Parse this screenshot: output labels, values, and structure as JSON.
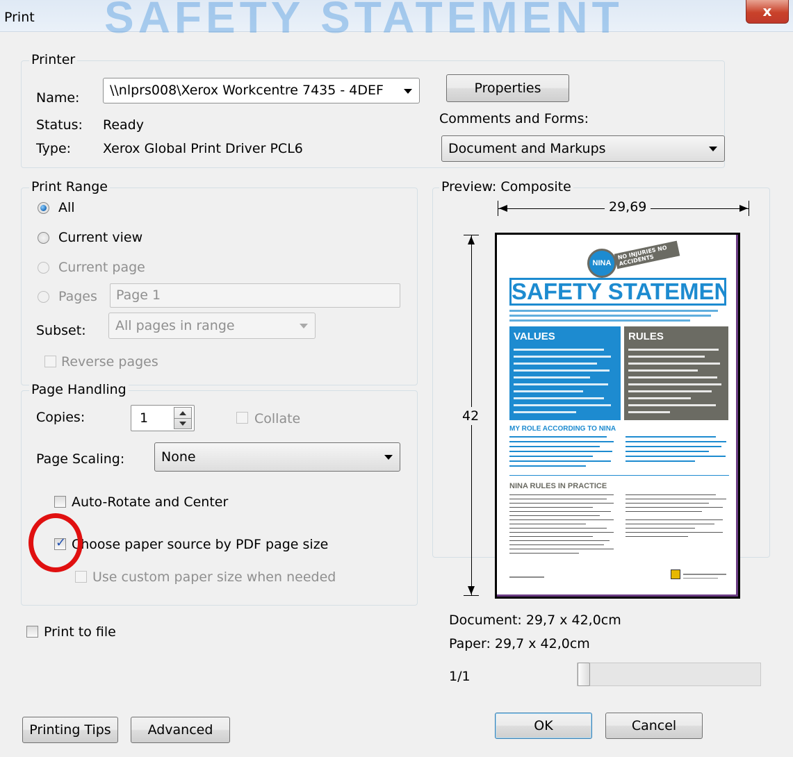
{
  "window": {
    "title": "Print",
    "background_watermark": "SAFETY STATEMENT",
    "close_glyph": "x"
  },
  "printer": {
    "legend": "Printer",
    "name_label": "Name:",
    "name_value": "\\\\nlprs008\\Xerox Workcentre 7435 - 4DEF",
    "status_label": "Status:",
    "status_value": "Ready",
    "type_label": "Type:",
    "type_value": "Xerox Global Print Driver PCL6",
    "properties_button": "Properties",
    "comments_label": "Comments and Forms:",
    "comments_value": "Document and Markups"
  },
  "print_range": {
    "legend": "Print Range",
    "all": "All",
    "current_view": "Current view",
    "current_page": "Current page",
    "pages": "Pages",
    "pages_value": "Page 1",
    "subset_label": "Subset:",
    "subset_value": "All pages in range",
    "reverse_pages": "Reverse pages",
    "selected": "all"
  },
  "page_handling": {
    "legend": "Page Handling",
    "copies_label": "Copies:",
    "copies_value": "1",
    "collate": "Collate",
    "scaling_label": "Page Scaling:",
    "scaling_value": "None",
    "auto_rotate": "Auto-Rotate and Center",
    "auto_rotate_checked": false,
    "choose_paper": "Choose paper source by PDF page size",
    "choose_paper_checked": true,
    "custom_paper": "Use custom paper size when needed",
    "custom_paper_checked": false
  },
  "print_to_file": "Print to file",
  "preview": {
    "legend": "Preview: Composite",
    "width_dim": "29,69",
    "height_dim": "42",
    "document_size": "Document: 29,7 x 42,0cm",
    "paper_size": "Paper: 29,7 x 42,0cm",
    "page_counter": "1/1",
    "page": {
      "badge": "NINA",
      "badge_tag": "NO INJURIES NO ACCIDENTS",
      "headline": "SAFETY STATEMENT",
      "values_heading": "VALUES",
      "rules_heading": "RULES",
      "role_heading": "MY ROLE ACCORDING TO NINA",
      "practice_heading": "NINA RULES IN PRACTICE"
    }
  },
  "buttons": {
    "printing_tips": "Printing Tips",
    "advanced": "Advanced",
    "ok": "OK",
    "cancel": "Cancel"
  },
  "colors": {
    "annotation_circle": "#e01010",
    "page_blue": "#1d8bd0",
    "page_gray": "#6b6b63"
  }
}
